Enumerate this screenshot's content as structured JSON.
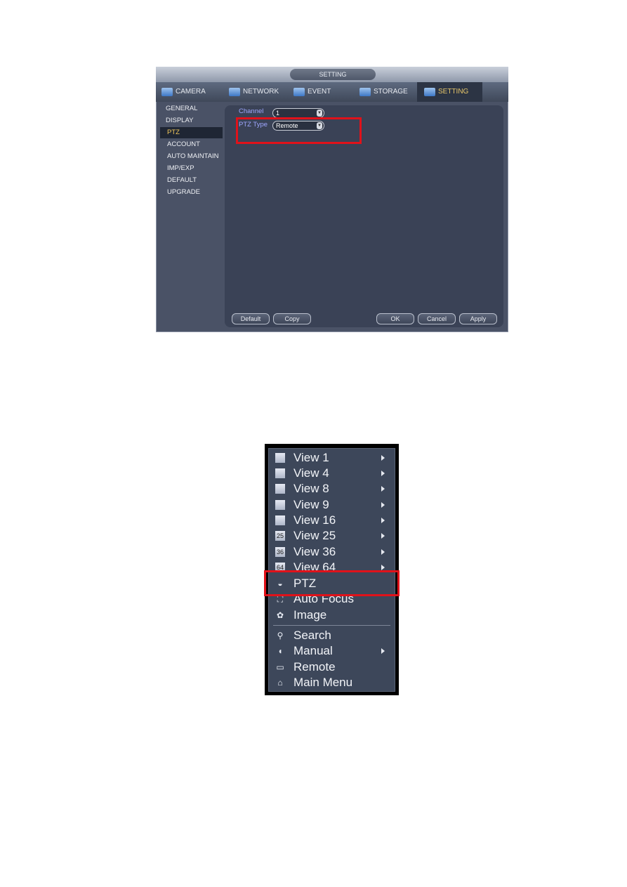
{
  "settings_window": {
    "title": "SETTING",
    "tabs": [
      {
        "label": "CAMERA",
        "icon": "camera-icon"
      },
      {
        "label": "NETWORK",
        "icon": "network-icon"
      },
      {
        "label": "EVENT",
        "icon": "event-icon"
      },
      {
        "label": "STORAGE",
        "icon": "storage-icon"
      },
      {
        "label": "SETTING",
        "icon": "setting-icon",
        "selected": true
      }
    ],
    "sidebar": [
      "GENERAL",
      "DISPLAY",
      "PTZ",
      "ACCOUNT",
      "AUTO MAINTAIN",
      "IMP/EXP",
      "DEFAULT",
      "UPGRADE"
    ],
    "sidebar_selected": "PTZ",
    "fields": {
      "channel_label": "Channel",
      "channel_value": "1",
      "ptz_type_label": "PTZ Type",
      "ptz_type_value": "Remote"
    },
    "buttons": {
      "default": "Default",
      "copy": "Copy",
      "ok": "OK",
      "cancel": "Cancel",
      "apply": "Apply"
    },
    "selected_color": "#f2c85b",
    "highlight_color": "#e0121a"
  },
  "context_menu": {
    "items": [
      {
        "label": "View 1",
        "icon": "view-1-icon",
        "submenu": true
      },
      {
        "label": "View 4",
        "icon": "view-4-icon",
        "submenu": true
      },
      {
        "label": "View 8",
        "icon": "view-8-icon",
        "submenu": true
      },
      {
        "label": "View 9",
        "icon": "view-9-icon",
        "submenu": true
      },
      {
        "label": "View 16",
        "icon": "view-16-icon",
        "submenu": true
      },
      {
        "label": "View 25",
        "icon": "view-25-icon",
        "submenu": true,
        "glyph": "25"
      },
      {
        "label": "View 36",
        "icon": "view-36-icon",
        "submenu": true,
        "glyph": "36"
      },
      {
        "label": "View 64",
        "icon": "view-64-icon",
        "submenu": true,
        "glyph": "64"
      },
      {
        "label": "PTZ",
        "icon": "ptz-dome-icon",
        "submenu": false
      },
      {
        "label": "Auto Focus",
        "icon": "auto-focus-icon",
        "submenu": false
      },
      {
        "label": "Image",
        "icon": "palette-icon",
        "submenu": false
      },
      {
        "label": "Search",
        "icon": "search-icon",
        "submenu": false
      },
      {
        "label": "Manual",
        "icon": "mouse-icon",
        "submenu": true
      },
      {
        "label": "Remote",
        "icon": "remote-device-icon",
        "submenu": false
      },
      {
        "label": "Main Menu",
        "icon": "home-icon",
        "submenu": false
      }
    ],
    "highlighted": "PTZ"
  }
}
